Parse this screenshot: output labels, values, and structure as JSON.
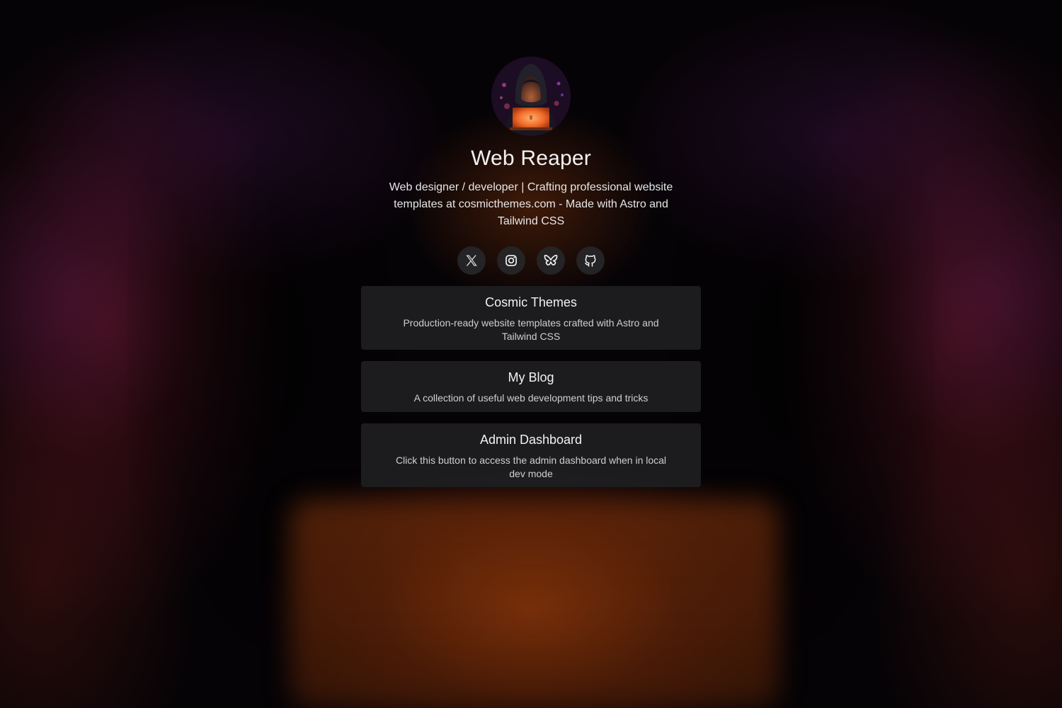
{
  "profile": {
    "name": "Web Reaper",
    "bio": "Web designer / developer | Crafting professional website templates at cosmicthemes.com - Made with Astro and Tailwind CSS",
    "avatar_icon": "hooded-hacker-avatar"
  },
  "socials": [
    {
      "icon": "x-twitter-icon"
    },
    {
      "icon": "instagram-icon"
    },
    {
      "icon": "bluesky-butterfly-icon"
    },
    {
      "icon": "github-icon"
    }
  ],
  "links": [
    {
      "title": "Cosmic Themes",
      "description": "Production-ready website templates crafted with Astro and Tailwind CSS"
    },
    {
      "title": "My Blog",
      "description": "A collection of useful web development tips and tricks"
    },
    {
      "title": "Admin Dashboard",
      "description": "Click this button to access the admin dashboard when in local dev mode"
    }
  ],
  "colors": {
    "card_background": "#1e1e20",
    "text_primary": "#f2f2f2",
    "text_secondary": "#cfcfcf",
    "accent_glow": "#e0641e"
  }
}
